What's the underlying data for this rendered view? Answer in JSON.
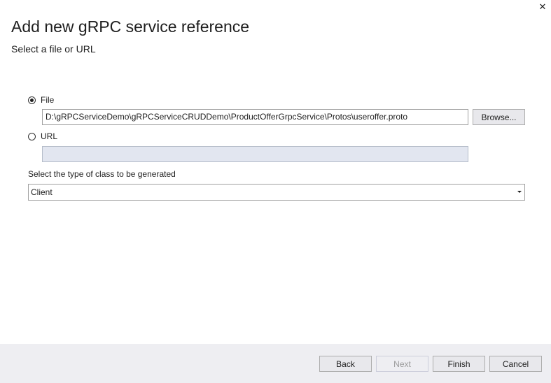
{
  "dialog": {
    "title": "Add new gRPC service reference",
    "subtitle": "Select a file or URL",
    "close_symbol": "✕"
  },
  "source": {
    "file_option": {
      "label": "File",
      "checked": true
    },
    "file_path": "D:\\gRPCServiceDemo\\gRPCServiceCRUDDemo\\ProductOfferGrpcService\\Protos\\useroffer.proto",
    "browse_label": "Browse...",
    "url_option": {
      "label": "URL",
      "checked": false
    },
    "url_value": ""
  },
  "class_type": {
    "label": "Select the type of class to be generated",
    "selected": "Client"
  },
  "footer": {
    "back_label": "Back",
    "next_label": "Next",
    "finish_label": "Finish",
    "cancel_label": "Cancel"
  },
  "icons": {
    "close": "close-icon",
    "dropdown": "chevron-down-icon"
  }
}
